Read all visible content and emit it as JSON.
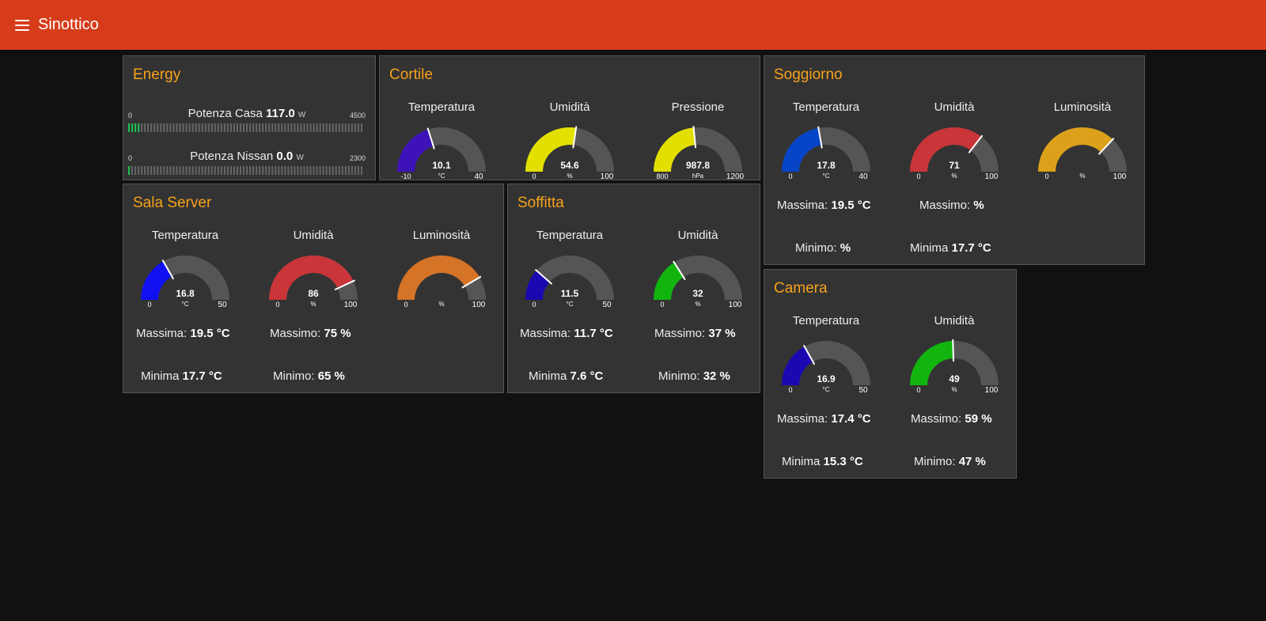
{
  "app": {
    "title": "Sinottico",
    "menu_icon": "hamburger-menu-icon",
    "bar_color": "#d63c1a"
  },
  "energy": {
    "title": "Energy",
    "bars": [
      {
        "label": "Potenza Casa",
        "value": "117.0",
        "unit": "W",
        "min": "0",
        "max": "4500",
        "fraction": 0.026
      },
      {
        "label": "Potenza Nissan",
        "value": "0.0",
        "unit": "W",
        "min": "0",
        "max": "2300",
        "fraction": 0.0
      }
    ]
  },
  "cortile": {
    "title": "Cortile",
    "gauges": [
      {
        "label": "Temperatura",
        "value": "10.1",
        "unit": "°C",
        "min": "-10",
        "max": "40",
        "fraction": 0.402,
        "color": "#3d12b8"
      },
      {
        "label": "Umidità",
        "value": "54.6",
        "unit": "%",
        "min": "0",
        "max": "100",
        "fraction": 0.546,
        "color": "#e3e000"
      },
      {
        "label": "Pressione",
        "value": "987.8",
        "unit": "hPa",
        "min": "800",
        "max": "1200",
        "fraction": 0.4695,
        "color": "#e3e000"
      }
    ]
  },
  "soggiorno": {
    "title": "Soggiorno",
    "gauges": [
      {
        "label": "Temperatura",
        "value": "17.8",
        "unit": "°C",
        "min": "0",
        "max": "40",
        "fraction": 0.445,
        "color": "#0645c8"
      },
      {
        "label": "Umidità",
        "value": "71",
        "unit": "%",
        "min": "0",
        "max": "100",
        "fraction": 0.71,
        "color": "#c93538"
      },
      {
        "label": "Luminosità",
        "value": "",
        "unit": "%",
        "min": "0",
        "max": "100",
        "fraction": 0.74,
        "color": "#dca11a"
      }
    ],
    "stats": {
      "max_temp_label": "Massima:",
      "max_temp_value": "19.5 °C",
      "max_hum_label": "Massimo:",
      "max_hum_value": "%",
      "min_temp_label": "Minimo:",
      "min_temp_value": "%",
      "min_hum_label": "Minima",
      "min_hum_value": "17.7 °C"
    }
  },
  "sala_server": {
    "title": "Sala Server",
    "gauges": [
      {
        "label": "Temperatura",
        "value": "16.8",
        "unit": "°C",
        "min": "0",
        "max": "50",
        "fraction": 0.336,
        "color": "#1010f0"
      },
      {
        "label": "Umidità",
        "value": "86",
        "unit": "%",
        "min": "0",
        "max": "100",
        "fraction": 0.86,
        "color": "#c93538"
      },
      {
        "label": "Luminosità",
        "value": "",
        "unit": "%",
        "min": "0",
        "max": "100",
        "fraction": 0.83,
        "color": "#d57326"
      }
    ],
    "stats": {
      "max_temp_label": "Massima:",
      "max_temp_value": "19.5 °C",
      "max_hum_label": "Massimo:",
      "max_hum_value": "75 %",
      "min_temp_label": "Minima",
      "min_temp_value": "17.7 °C",
      "min_hum_label": "Minimo:",
      "min_hum_value": "65 %"
    }
  },
  "soffitta": {
    "title": "Soffitta",
    "gauges": [
      {
        "label": "Temperatura",
        "value": "11.5",
        "unit": "°C",
        "min": "0",
        "max": "50",
        "fraction": 0.23,
        "color": "#1a08b0"
      },
      {
        "label": "Umidità",
        "value": "32",
        "unit": "%",
        "min": "0",
        "max": "100",
        "fraction": 0.32,
        "color": "#11b50e"
      }
    ],
    "stats": {
      "max_temp_label": "Massima:",
      "max_temp_value": "11.7 °C",
      "max_hum_label": "Massimo:",
      "max_hum_value": "37 %",
      "min_temp_label": "Minima",
      "min_temp_value": "7.6 °C",
      "min_hum_label": "Minimo:",
      "min_hum_value": "32 %"
    }
  },
  "camera": {
    "title": "Camera",
    "gauges": [
      {
        "label": "Temperatura",
        "value": "16.9",
        "unit": "°C",
        "min": "0",
        "max": "50",
        "fraction": 0.338,
        "color": "#1a08b0"
      },
      {
        "label": "Umidità",
        "value": "49",
        "unit": "%",
        "min": "0",
        "max": "100",
        "fraction": 0.49,
        "color": "#11b50e"
      }
    ],
    "stats": {
      "max_temp_label": "Massima:",
      "max_temp_value": "17.4 °C",
      "max_hum_label": "Massimo:",
      "max_hum_value": "59 %",
      "min_temp_label": "Minima",
      "min_temp_value": "15.3 °C",
      "min_hum_label": "Minimo:",
      "min_hum_value": "47 %"
    }
  }
}
